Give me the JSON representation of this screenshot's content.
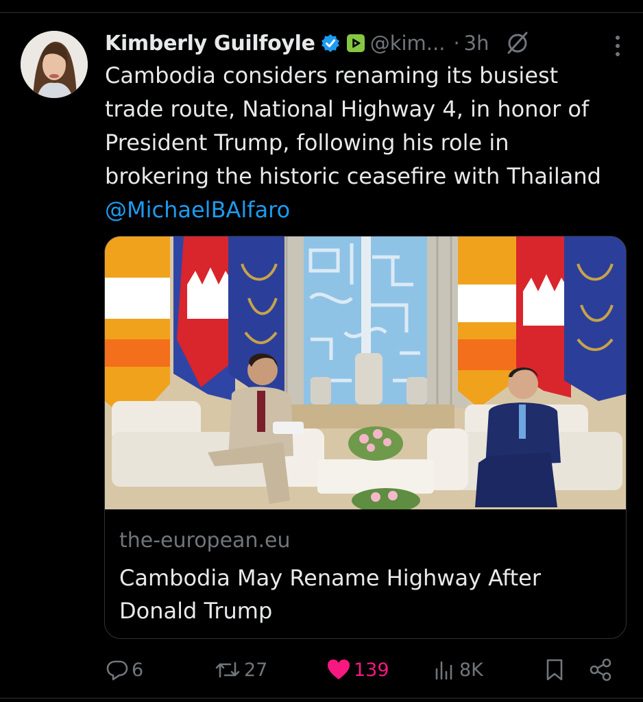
{
  "tweet": {
    "author_name": "Kimberly Guilfoyle",
    "handle": "@kim...",
    "separator": "·",
    "time": "3h",
    "text": "Cambodia considers renaming its busiest\ntrade route, National Highway 4, in honor of\nPresident Trump, following his role in\nbrokering the historic ceasefire with Thailand",
    "mention": "@MichaelBAlfaro"
  },
  "card": {
    "domain": "the-european.eu",
    "title": "Cambodia May Rename Highway After Donald Trump"
  },
  "actions": {
    "replies": "6",
    "reposts": "27",
    "likes": "139",
    "views": "8K"
  },
  "icons": {
    "verified": "verified-badge-icon",
    "affiliate": "rumble-badge-icon",
    "grok": "grok-icon",
    "more": "more-icon",
    "reply": "reply-icon",
    "repost": "repost-icon",
    "like": "heart-icon",
    "views": "views-icon",
    "bookmark": "bookmark-icon",
    "share": "share-icon"
  },
  "colors": {
    "background": "#000000",
    "text": "#e7e9ea",
    "muted": "#71767b",
    "link": "#1d9bf0",
    "like": "#f91880",
    "verified": "#1d9bf0",
    "badge": "#85c742"
  }
}
